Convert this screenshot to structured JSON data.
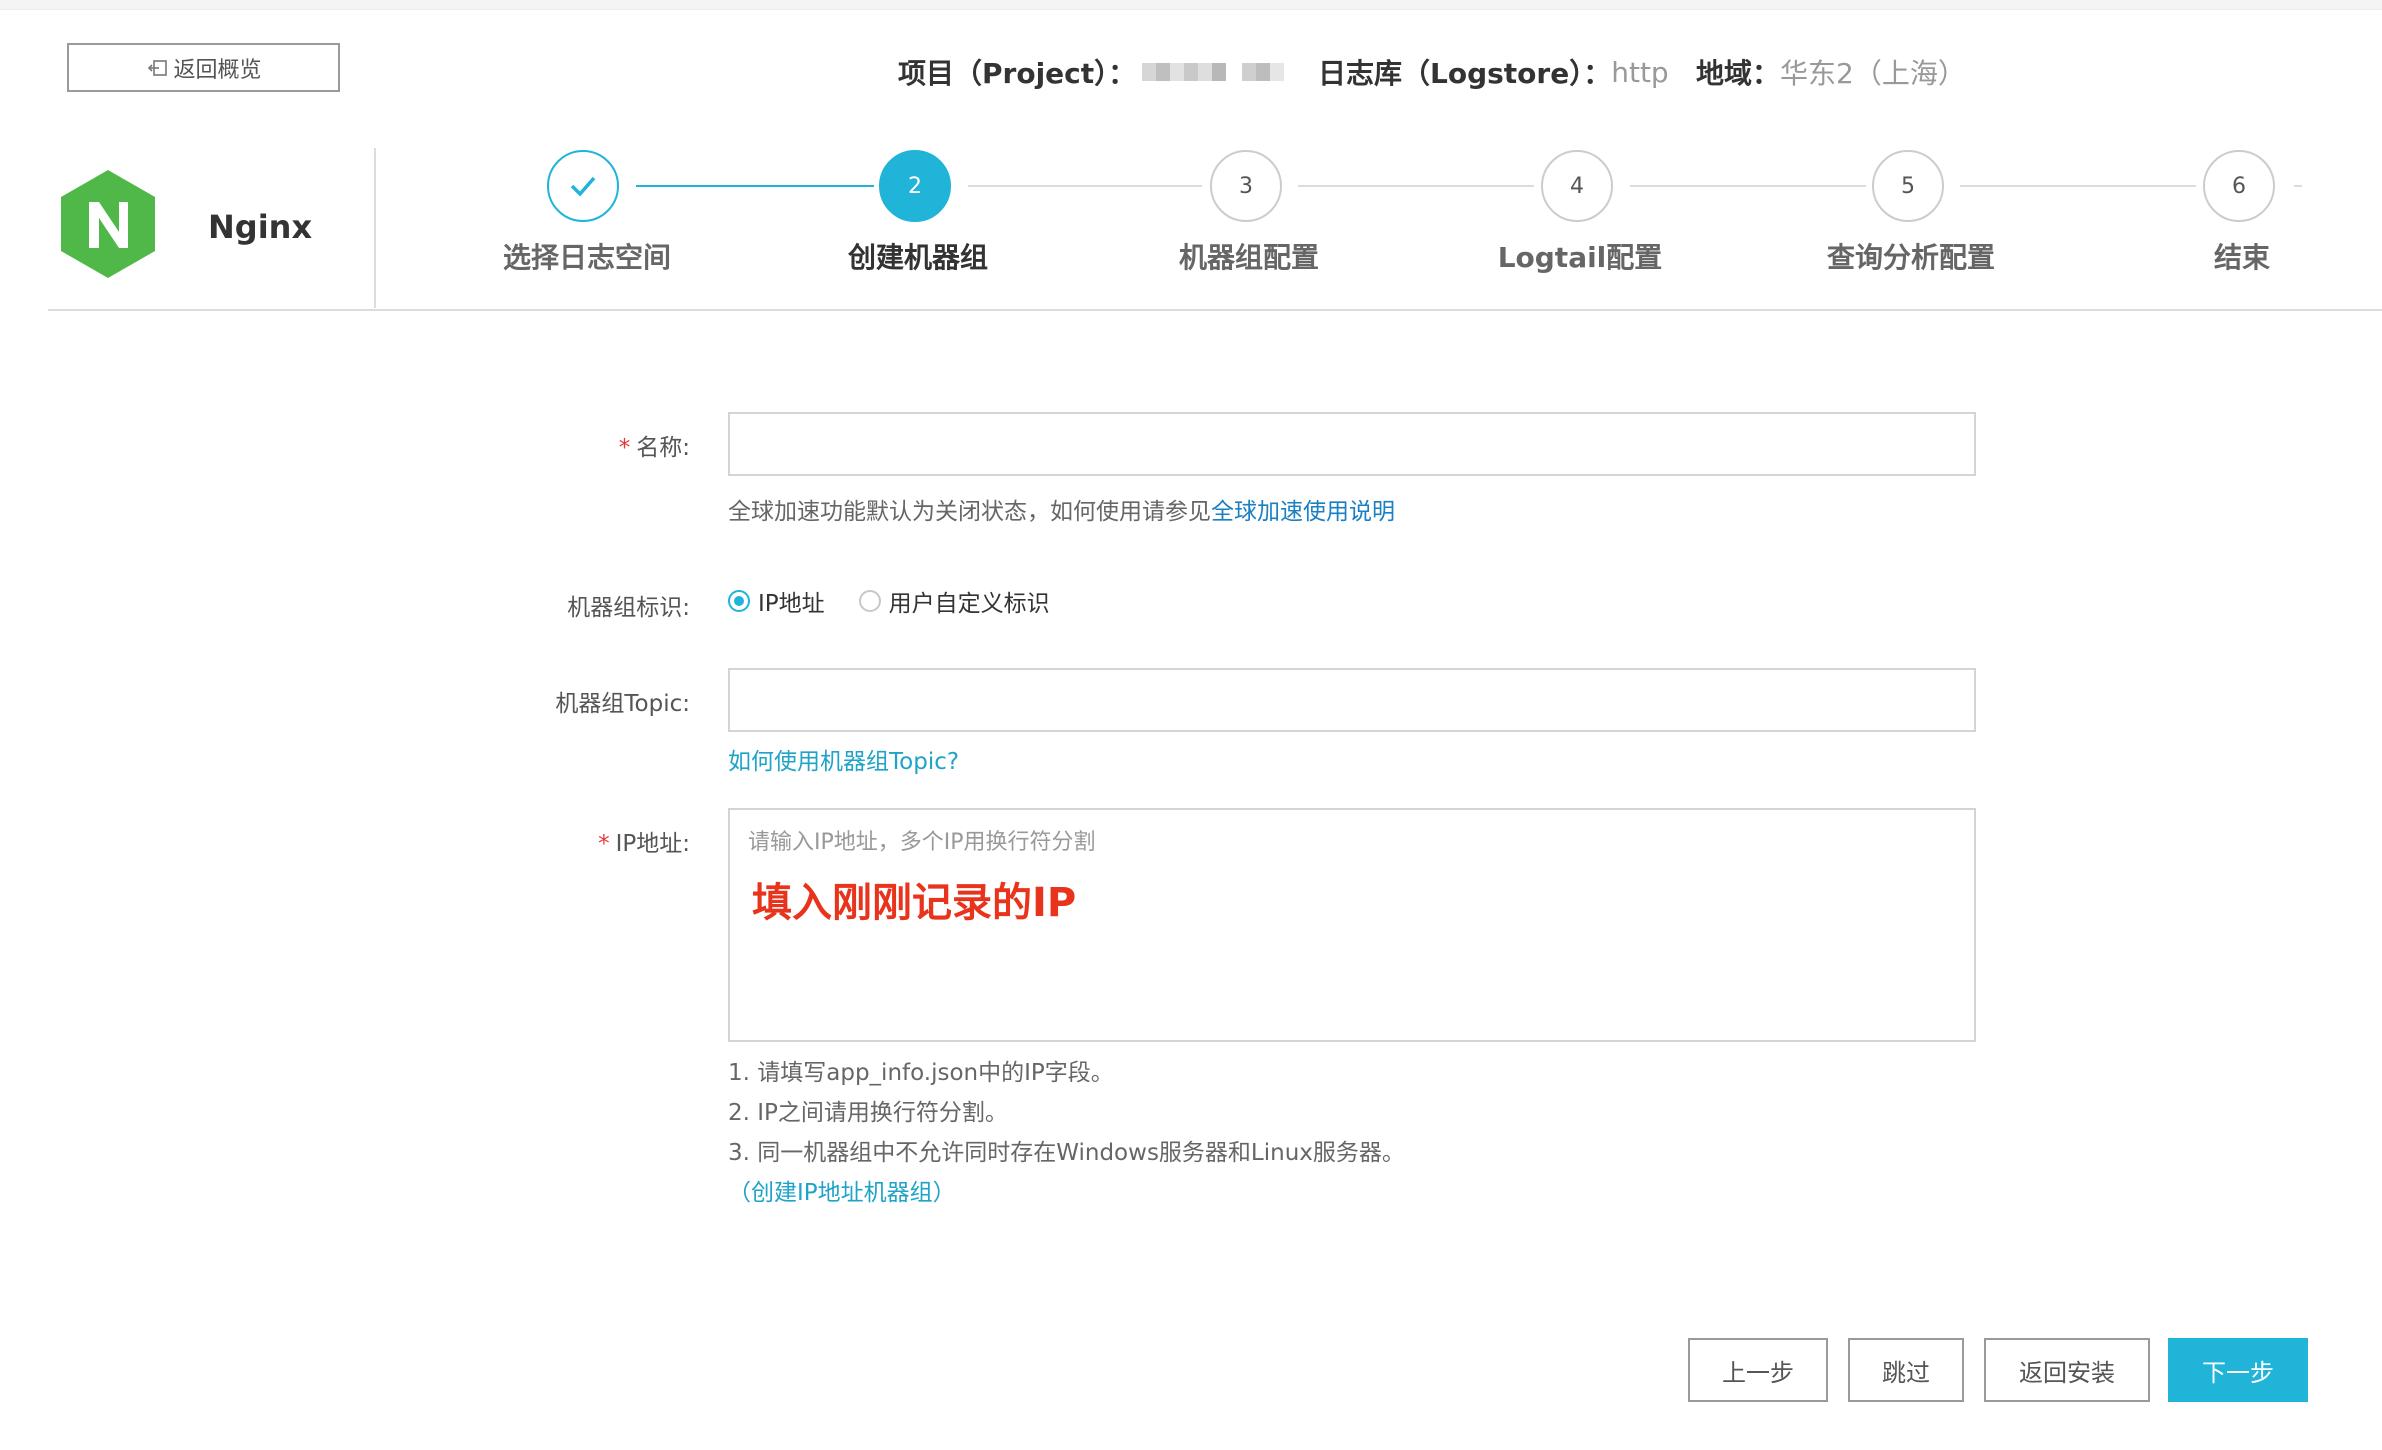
{
  "header": {
    "back_label": "返回概览",
    "project_key": "项目（Project）：",
    "logstore_key": "日志库（Logstore）：",
    "logstore_value": "http",
    "region_key": "地域：",
    "region_value": "华东2（上海）"
  },
  "wizard": {
    "app_name": "Nginx",
    "steps": [
      {
        "number": "1",
        "label": "选择日志空间",
        "state": "done"
      },
      {
        "number": "2",
        "label": "创建机器组",
        "state": "active"
      },
      {
        "number": "3",
        "label": "机器组配置",
        "state": "pending"
      },
      {
        "number": "4",
        "label": "Logtail配置",
        "state": "pending"
      },
      {
        "number": "5",
        "label": "查询分析配置",
        "state": "pending"
      },
      {
        "number": "6",
        "label": "结束",
        "state": "pending"
      }
    ]
  },
  "form": {
    "name_label": "名称:",
    "name_value": "",
    "accel_text": "全球加速功能默认为关闭状态，如何使用请参见",
    "accel_link": "全球加速使用说明",
    "identity_label": "机器组标识:",
    "identity_options": [
      "IP地址",
      "用户自定义标识"
    ],
    "identity_selected": "IP地址",
    "topic_label": "机器组Topic:",
    "topic_value": "",
    "topic_help_link": "如何使用机器组Topic?",
    "ip_label": "IP地址:",
    "ip_placeholder": "请输入IP地址，多个IP用换行符分割",
    "annotation": "填入刚刚记录的IP",
    "notes": [
      "1. 请填写app_info.json中的IP字段。",
      "2. IP之间请用换行符分割。",
      "3. 同一机器组中不允许同时存在Windows服务器和Linux服务器。"
    ],
    "create_link": "（创建IP地址机器组）"
  },
  "actions": {
    "prev": "上一步",
    "skip": "跳过",
    "back_install": "返回安装",
    "next": "下一步"
  },
  "colors": {
    "accent": "#1fb4d8",
    "required": "#e4393c",
    "annotation": "#e8341c",
    "logo": "#4fb848"
  }
}
